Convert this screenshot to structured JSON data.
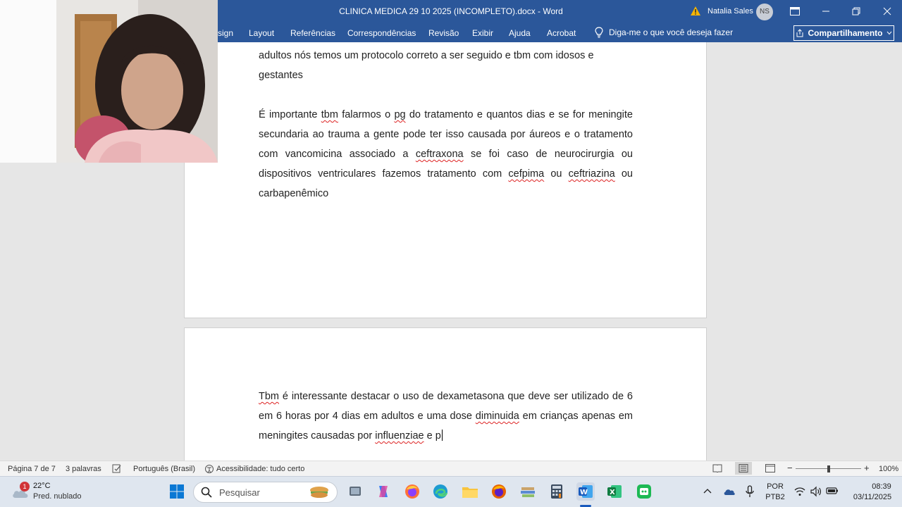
{
  "window": {
    "title": "CLINICA MEDICA 29 10 2025 (INCOMPLETO).docx  -  Word",
    "user_name": "Natalia Sales",
    "user_initials": "NS",
    "accent_color": "#2b579a"
  },
  "ribbon": {
    "tabs": [
      "sign",
      "Layout",
      "Referências",
      "Correspondências",
      "Revisão",
      "Exibir",
      "Ajuda",
      "Acrobat"
    ],
    "tell_me": "Diga-me o que você deseja fazer",
    "share": "Compartilhamento"
  },
  "document": {
    "page1_top_line": "adultos nós temos um protocolo correto a ser seguido e tbm com idosos e",
    "page1_line2": "gestantes",
    "p2": {
      "a": "É importante ",
      "w1": "tbm",
      "b": " falarmos o ",
      "w2": "pg",
      "c": " do tratamento e quantos dias e se for meningite secundaria ao trauma a gente pode ter isso causada por áureos e o tratamento com vancomicina associado a ",
      "w3": "ceftraxona",
      "d": " se foi caso de neurocirurgia ou dispositivos ventriculares fazemos tratamento com ",
      "w4": "cefpima",
      "e": " ou ",
      "w5": "ceftriazina",
      "f": " ou carbapenêmico"
    },
    "p3": {
      "w1": "Tbm",
      "a": " é interessante destacar o uso de dexametasona que deve ser utilizado de 6 em 6 horas por 4 dias em adultos e uma dose ",
      "w2": "diminuida",
      "b": " em crianças apenas em meningites causadas por ",
      "w3": "influenziae",
      "c": " e p"
    }
  },
  "status": {
    "page": "Página 7 de 7",
    "words": "3 palavras",
    "language": "Português (Brasil)",
    "accessibility": "Acessibilidade: tudo certo",
    "zoom": "100%",
    "zoom_level": 1.0
  },
  "taskbar": {
    "weather_badge": "1",
    "temperature": "22°C",
    "weather_desc": "Pred. nublado",
    "search_placeholder": "Pesquisar",
    "lang_top": "POR",
    "lang_bottom": "PTB2",
    "time": "08:39",
    "date": "03/11/2025"
  }
}
